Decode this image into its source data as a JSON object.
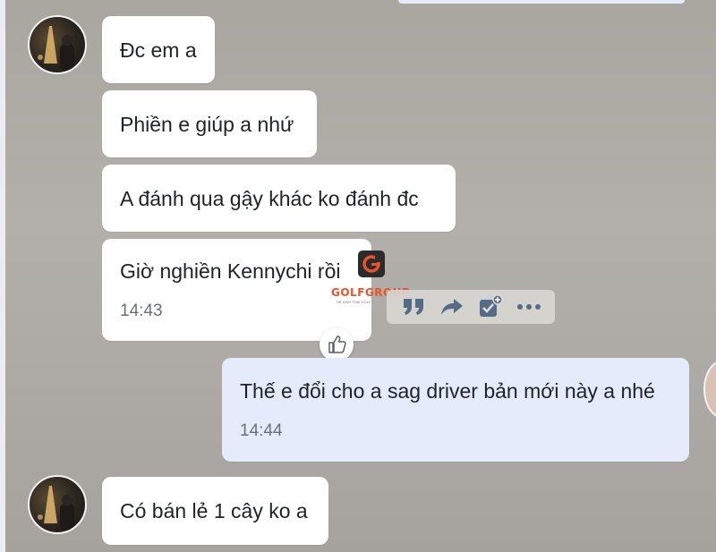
{
  "messages": [
    {
      "text": "Đc em a"
    },
    {
      "text": "Phiền e giúp a nhứ"
    },
    {
      "text": "A đánh qua gậy khác ko đánh đc"
    },
    {
      "text": "Giờ nghiền Kennychi rồi",
      "time": "14:43"
    },
    {
      "text": "Thế e đổi cho a sag driver bản mới này a nhé",
      "time": "14:44",
      "mine": true
    },
    {
      "text": "Có bán lẻ 1 cây ko a"
    }
  ],
  "watermark": {
    "brand": "GOLFGROUP",
    "letter": "G",
    "tagline": "HỆ SINH THÁI GOLF"
  },
  "icons": {
    "quote": "quote-icon",
    "share": "share-icon",
    "todo": "add-todo-icon",
    "more": "more-icon",
    "like": "thumbs-up-icon"
  },
  "colors": {
    "incoming_bubble": "#ffffff",
    "outgoing_bubble": "#e4ecfb",
    "icon_tint": "#566b86"
  }
}
